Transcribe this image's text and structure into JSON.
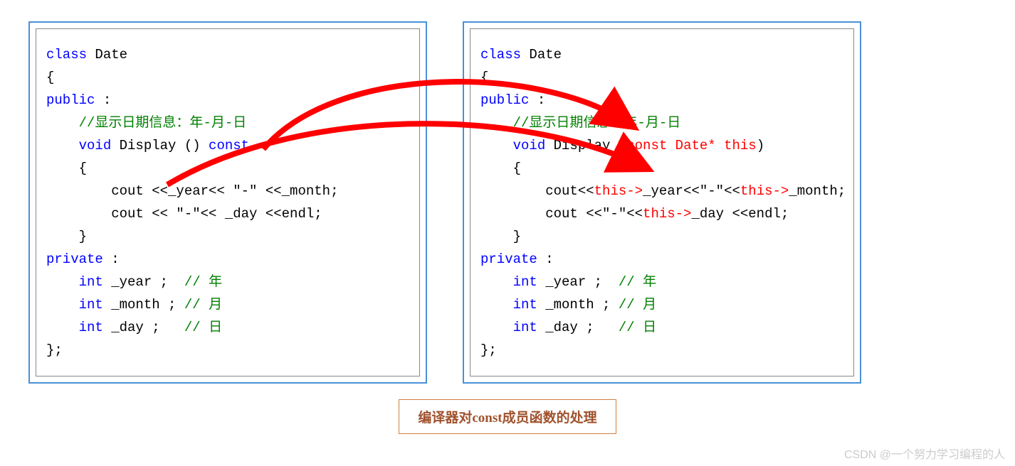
{
  "left": {
    "l1a": "class",
    "l1b": " Date",
    "l2": "{",
    "l3a": "public",
    "l3b": " :",
    "l4": "    //显示日期信息：年-月-日",
    "l5a": "    ",
    "l5b": "void",
    "l5c": " Display () ",
    "l5d": "const",
    "l6": "    {",
    "l7": "        cout <<_year<< \"-\" <<_month;",
    "l8": "        cout << \"-\"<< _day <<endl;",
    "l9": "    }",
    "l10a": "private",
    "l10b": " :",
    "l11a": "    ",
    "l11b": "int",
    "l11c": " _year ;  ",
    "l11d": "// 年",
    "l12a": "    ",
    "l12b": "int",
    "l12c": " _month ; ",
    "l12d": "// 月",
    "l13a": "    ",
    "l13b": "int",
    "l13c": " _day ;   ",
    "l13d": "// 日",
    "l14": "};"
  },
  "right": {
    "l1a": "class",
    "l1b": " Date",
    "l2": "{",
    "l3a": "public",
    "l3b": " :",
    "l4": "    //显示日期信息：年-月-日",
    "l5a": "    ",
    "l5b": "void",
    "l5c": " Display (",
    "l5d": "const Date* this",
    "l5e": ")",
    "l6": "    {",
    "l7a": "        cout<<",
    "l7b": "this->",
    "l7c": "_year<<\"-\"<<",
    "l7d": "this->",
    "l7e": "_month;",
    "l8a": "        cout <<\"-\"<<",
    "l8b": "this->",
    "l8c": "_day <<endl;",
    "l9": "    }",
    "l10a": "private",
    "l10b": " :",
    "l11a": "    ",
    "l11b": "int",
    "l11c": " _year ;  ",
    "l11d": "// 年",
    "l12a": "    ",
    "l12b": "int",
    "l12c": " _month ; ",
    "l12d": "// 月",
    "l13a": "    ",
    "l13b": "int",
    "l13c": " _day ;   ",
    "l13d": "// 日",
    "l14": "};"
  },
  "caption": "编译器对const成员函数的处理",
  "watermark": "CSDN @一个努力学习编程的人"
}
